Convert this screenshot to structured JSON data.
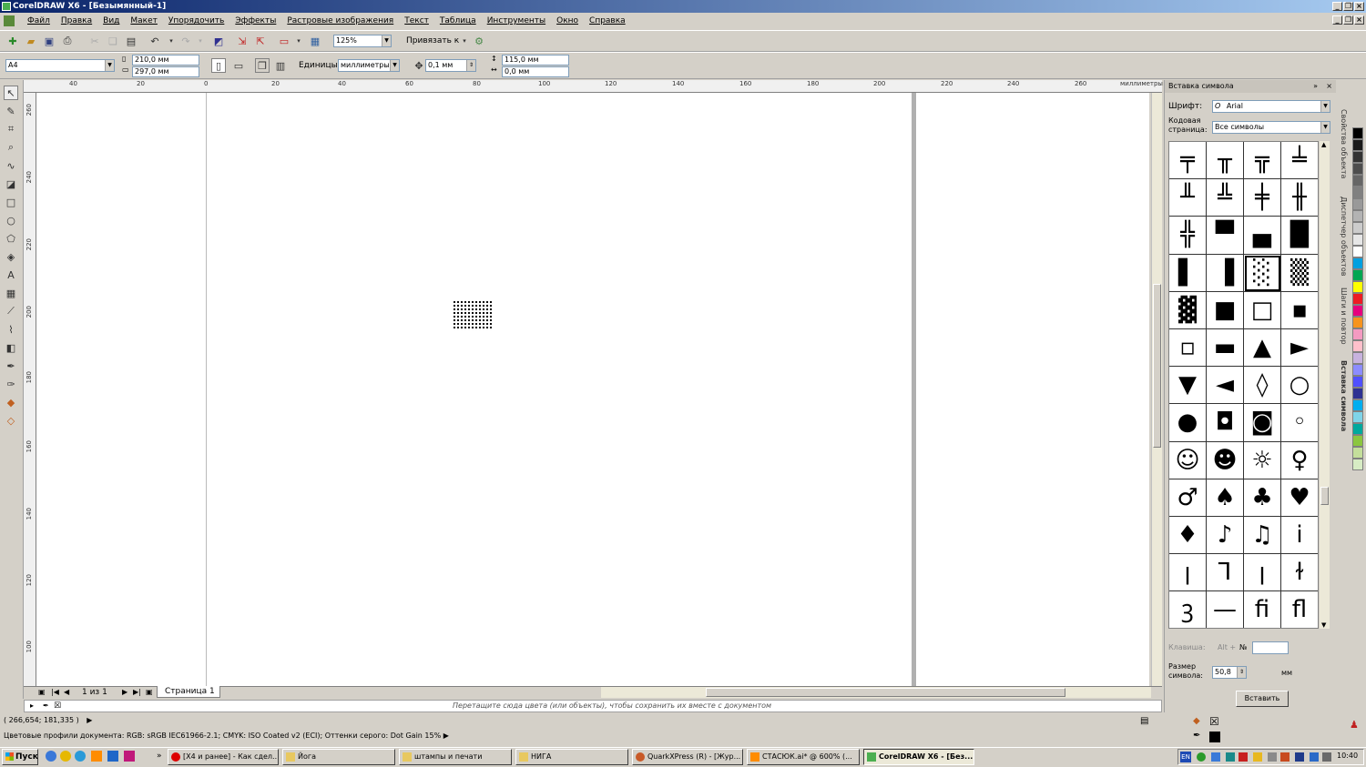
{
  "window": {
    "title": "CorelDRAW X6 - [Безымянный-1]"
  },
  "menu": [
    "Файл",
    "Правка",
    "Вид",
    "Макет",
    "Упорядочить",
    "Эффекты",
    "Растровые изображения",
    "Текст",
    "Таблица",
    "Инструменты",
    "Окно",
    "Справка"
  ],
  "toolbar": {
    "zoom": "125%",
    "snap": "Привязать к"
  },
  "propbar": {
    "page_size": "A4",
    "width": "210,0 мм",
    "height": "297,0 мм",
    "units_label": "Единицы:",
    "units": "миллиметры",
    "nudge": "0,1 мм",
    "dup_x": "115,0 мм",
    "dup_y": "0,0 мм"
  },
  "ruler": {
    "h_ticks": [
      "40",
      "20",
      "0",
      "20",
      "40",
      "60",
      "80",
      "100",
      "120",
      "140",
      "160",
      "180",
      "200",
      "220",
      "240",
      "260"
    ],
    "h_unit": "миллиметры",
    "v_ticks": [
      "260",
      "240",
      "220",
      "200",
      "180",
      "160",
      "140",
      "120",
      "100"
    ],
    "v_unit": "миллиметры"
  },
  "pagenav": {
    "counter": "1 из 1",
    "page_tab": "Страница 1"
  },
  "colorbar": {
    "hint": "Перетащите сюда цвета (или объекты), чтобы сохранить их вместе с документом"
  },
  "status": {
    "coords": "( 266,654; 181,335 )",
    "profiles": "Цветовые профили документа: RGB: sRGB IEC61966-2.1; CMYK: ISO Coated v2 (ECI); Оттенки серого: Dot Gain 15%"
  },
  "docker": {
    "title": "Вставка символа",
    "font_label": "Шрифт:",
    "font": "Arial",
    "codepage_label": "Кодовая страница:",
    "codepage": "Все символы",
    "glyphs": [
      "╤",
      "╥",
      "╦",
      "╧",
      "╨",
      "╩",
      "╪",
      "╫",
      "╬",
      "▀",
      "▄",
      "█",
      "▌",
      "▐",
      "░",
      "▒",
      "▓",
      "■",
      "□",
      "▪",
      "▫",
      "▬",
      "▲",
      "►",
      "▼",
      "◄",
      "◊",
      "○",
      "●",
      "◘",
      "◙",
      "◦",
      "☺",
      "☻",
      "☼",
      "♀",
      "♂",
      "♠",
      "♣",
      "♥",
      "♦",
      "♪",
      "♫",
      "ⅰ",
      "ꞁ",
      "Ꞁ",
      "ꞁ",
      "ɫ",
      "ꝫ",
      "—",
      "ﬁ",
      "ﬂ"
    ],
    "selected_glyph": "░",
    "key_label": "Клавиша:",
    "key_prefix": "Alt +",
    "num_label": "№",
    "size_label": "Размер символа:",
    "size": "50,8",
    "size_unit": "мм",
    "insert_button": "Вставить",
    "tabs": [
      "Свойства объекта",
      "Диспетчер объектов",
      "Шаги и повтор",
      "Вставка символа"
    ]
  },
  "palette": [
    "#000000",
    "#1a1a1a",
    "#333333",
    "#4d4d4d",
    "#666666",
    "#808080",
    "#999999",
    "#b3b3b3",
    "#cccccc",
    "#e6e6e6",
    "#ffffff",
    "#00a0e0",
    "#00a651",
    "#ffff00",
    "#ed1c24",
    "#e6007e",
    "#f7941d",
    "#f49ac1",
    "#ffc0cb",
    "#c7b2de",
    "#8c8cff",
    "#5050ff",
    "#2e3192",
    "#00aeef",
    "#7fd4e8",
    "#00a99d",
    "#8cc63f",
    "#c4df9b",
    "#d7ecc4"
  ],
  "taskbar": {
    "start": "Пуск",
    "tasks": [
      "[X4 и ранее] - Как сдел...",
      "Йога",
      "штампы и печати",
      "НИГА",
      "QuarkXPress (R) - [Жур...",
      "СТАСЮК.ai* @ 600% (...",
      "CorelDRAW X6 - [Без..."
    ],
    "lang": "EN",
    "clock": "10:40"
  }
}
